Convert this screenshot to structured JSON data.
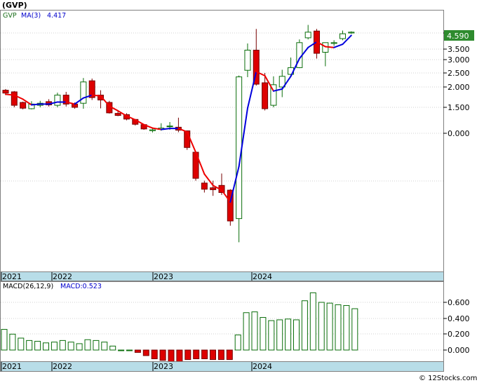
{
  "chart_data": [
    {
      "type": "candlestick",
      "title": "(GVP)",
      "legend": {
        "symbol": "GVP",
        "ma_label": "MA(3)",
        "ma_value": "4.417"
      },
      "last_price_label": "4.590",
      "y_ticks": [
        "4.500",
        "3.500",
        "3.000",
        "2.500",
        "2.000",
        "1.500",
        "0.000"
      ],
      "x_labels": [
        "2021",
        "2022",
        "2023",
        "2024"
      ],
      "colors": {
        "up_fill": "#ffffff",
        "up_stroke": "#0a6e0a",
        "down_fill": "#dd0000",
        "down_stroke": "#770000",
        "ma_up": "#0000dd",
        "ma_down": "#ee0000",
        "axis_band": "#b8dde8"
      },
      "candles": [
        {
          "o": 1.92,
          "h": 1.95,
          "l": 1.8,
          "c": 1.85
        },
        {
          "o": 1.88,
          "h": 1.9,
          "l": 1.5,
          "c": 1.55
        },
        {
          "o": 1.62,
          "h": 1.64,
          "l": 1.38,
          "c": 1.45
        },
        {
          "o": 1.42,
          "h": 1.65,
          "l": 1.38,
          "c": 1.58
        },
        {
          "o": 1.55,
          "h": 1.66,
          "l": 1.5,
          "c": 1.6
        },
        {
          "o": 1.64,
          "h": 1.7,
          "l": 1.52,
          "c": 1.56
        },
        {
          "o": 1.55,
          "h": 1.86,
          "l": 1.5,
          "c": 1.8
        },
        {
          "o": 1.8,
          "h": 1.88,
          "l": 1.52,
          "c": 1.58
        },
        {
          "o": 1.58,
          "h": 1.62,
          "l": 1.42,
          "c": 1.5
        },
        {
          "o": 1.6,
          "h": 2.32,
          "l": 1.42,
          "c": 2.18
        },
        {
          "o": 2.22,
          "h": 2.3,
          "l": 1.68,
          "c": 1.74
        },
        {
          "o": 1.8,
          "h": 1.92,
          "l": 1.44,
          "c": 1.68
        },
        {
          "o": 1.62,
          "h": 1.66,
          "l": 1.14,
          "c": 1.18
        },
        {
          "o": 1.15,
          "h": 1.28,
          "l": 0.99,
          "c": 1.03
        },
        {
          "o": 1.08,
          "h": 1.16,
          "l": 0.75,
          "c": 0.82
        },
        {
          "o": 0.8,
          "h": 0.82,
          "l": 0.45,
          "c": 0.52
        },
        {
          "o": 0.5,
          "h": 0.52,
          "l": 0.2,
          "c": 0.25
        },
        {
          "o": 0.15,
          "h": 0.28,
          "l": 0.05,
          "c": 0.2
        },
        {
          "o": 0.22,
          "h": 0.58,
          "l": 0.15,
          "c": 0.3
        },
        {
          "o": 0.38,
          "h": 0.65,
          "l": 0.2,
          "c": 0.42
        },
        {
          "o": 0.35,
          "h": 0.9,
          "l": 0.06,
          "c": 0.18
        },
        {
          "o": 0.14,
          "h": 0.16,
          "l": -0.35,
          "c": -0.3
        },
        {
          "o": -0.4,
          "h": -0.4,
          "l": -1.0,
          "c": -0.95
        },
        {
          "o": -1.05,
          "h": -1.0,
          "l": -1.25,
          "c": -1.18
        },
        {
          "o": -1.15,
          "h": -1.0,
          "l": -1.32,
          "c": -1.19
        },
        {
          "o": -1.1,
          "h": -0.85,
          "l": -1.3,
          "c": -1.25
        },
        {
          "o": -1.2,
          "h": -1.18,
          "l": -1.95,
          "c": -1.85
        },
        {
          "o": -1.8,
          "h": 2.41,
          "l": -2.3,
          "c": 2.36
        },
        {
          "o": 2.6,
          "h": 3.85,
          "l": 2.35,
          "c": 3.45
        },
        {
          "o": 3.45,
          "h": 4.75,
          "l": 2.05,
          "c": 2.1
        },
        {
          "o": 2.15,
          "h": 2.5,
          "l": 1.32,
          "c": 1.42
        },
        {
          "o": 1.55,
          "h": 2.38,
          "l": 1.5,
          "c": 2.08
        },
        {
          "o": 2.0,
          "h": 2.62,
          "l": 1.75,
          "c": 2.38
        },
        {
          "o": 2.45,
          "h": 3.1,
          "l": 2.4,
          "c": 2.7
        },
        {
          "o": 2.7,
          "h": 4.1,
          "l": 2.68,
          "c": 3.9
        },
        {
          "o": 4.2,
          "h": 5.0,
          "l": 4.1,
          "c": 4.55
        },
        {
          "o": 4.62,
          "h": 4.75,
          "l": 3.05,
          "c": 3.3
        },
        {
          "o": 3.35,
          "h": 3.9,
          "l": 2.75,
          "c": 3.9
        },
        {
          "o": 3.85,
          "h": 4.05,
          "l": 3.7,
          "c": 3.9
        },
        {
          "o": 4.15,
          "h": 4.65,
          "l": 4.05,
          "c": 4.45
        },
        {
          "o": 4.5,
          "h": 4.6,
          "l": 4.45,
          "c": 4.55
        }
      ],
      "ma3": [
        1.82,
        1.8,
        1.7,
        1.56,
        1.58,
        1.58,
        1.63,
        1.63,
        1.58,
        1.73,
        1.8,
        1.78,
        1.53,
        1.3,
        1.0,
        0.78,
        0.5,
        0.3,
        0.22,
        0.28,
        0.28,
        0.08,
        -0.4,
        -0.86,
        -1.1,
        -1.2,
        -1.45,
        -0.7,
        1.45,
        2.55,
        2.4,
        1.9,
        1.95,
        2.38,
        3.05,
        3.6,
        3.95,
        3.65,
        3.6,
        3.8,
        4.35
      ],
      "ma3_color": [
        "d",
        "d",
        "d",
        "d",
        "u",
        "u",
        "u",
        "u",
        "d",
        "u",
        "u",
        "d",
        "d",
        "d",
        "d",
        "d",
        "d",
        "d",
        "d",
        "u",
        "u",
        "d",
        "d",
        "d",
        "d",
        "d",
        "d",
        "u",
        "u",
        "u",
        "d",
        "d",
        "u",
        "u",
        "u",
        "u",
        "u",
        "d",
        "d",
        "u",
        "u"
      ]
    },
    {
      "type": "bar",
      "legend": {
        "label": "MACD(26,12,9)",
        "value_label": "MACD:0.523"
      },
      "y_ticks": [
        "0.600",
        "0.400",
        "0.200",
        "0.000"
      ],
      "x_labels": [
        "2021",
        "2022",
        "2023",
        "2024"
      ],
      "values": [
        0.26,
        0.2,
        0.15,
        0.12,
        0.11,
        0.09,
        0.1,
        0.12,
        0.1,
        0.08,
        0.13,
        0.12,
        0.1,
        0.05,
        0.0,
        0.0,
        -0.03,
        -0.07,
        -0.11,
        -0.13,
        -0.16,
        -0.15,
        -0.12,
        -0.11,
        -0.11,
        -0.12,
        -0.12,
        -0.12,
        0.19,
        0.47,
        0.48,
        0.41,
        0.37,
        0.38,
        0.39,
        0.38,
        0.62,
        0.72,
        0.6,
        0.59,
        0.57,
        0.56,
        0.52
      ]
    }
  ],
  "watermark": "© 12Stocks.com"
}
